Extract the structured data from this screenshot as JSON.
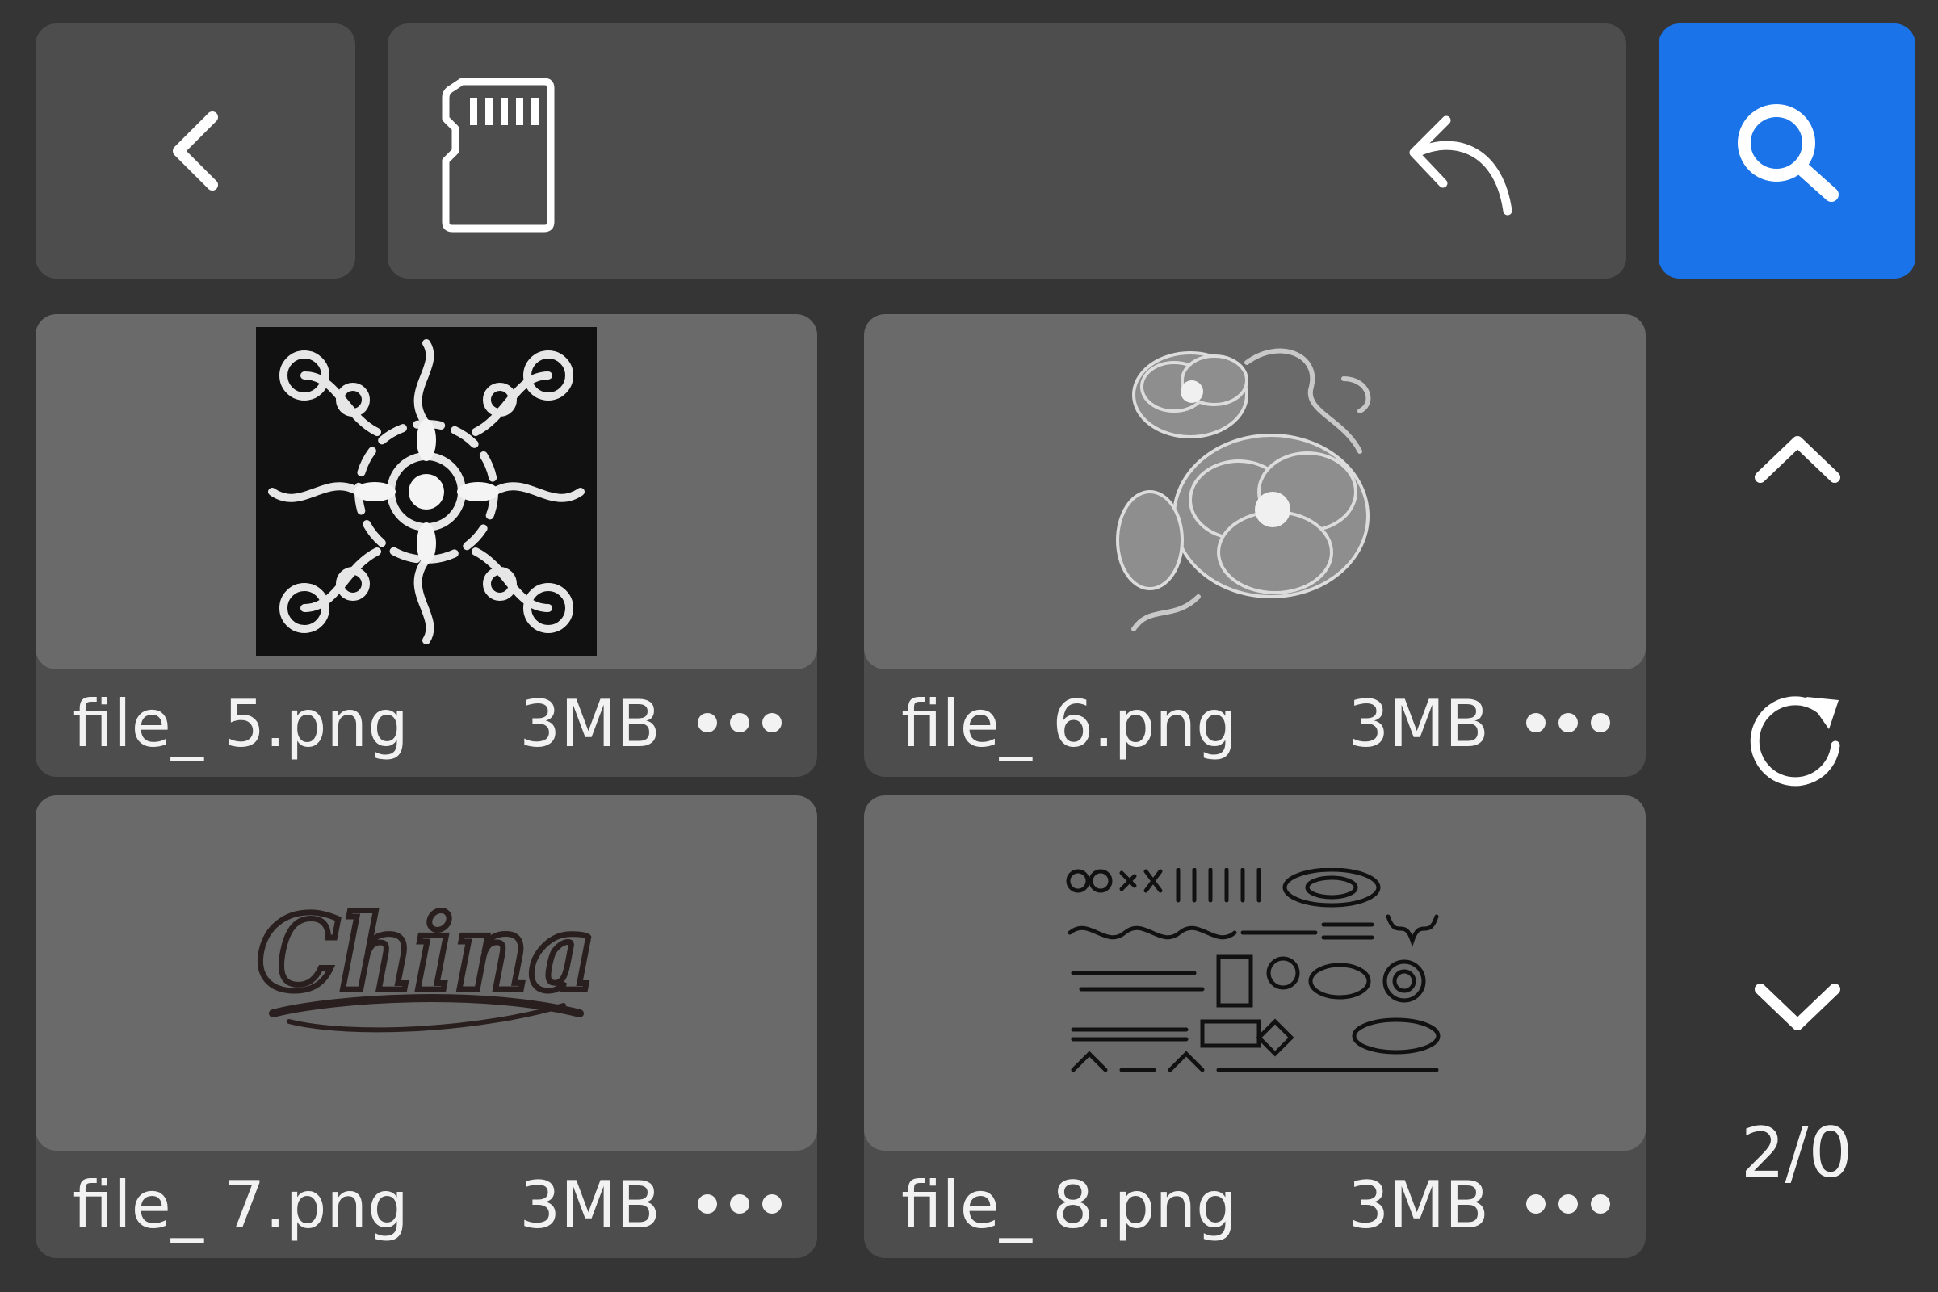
{
  "toolbar": {
    "back_icon": "chevron-left-icon",
    "storage_icon": "sd-card-icon",
    "up_icon": "undo-arrow-icon",
    "search_icon": "search-icon",
    "accent_color": "#1a73e8"
  },
  "files": [
    {
      "name": "file_ 5.png",
      "size": "3MB",
      "thumb": "ornamental-tile"
    },
    {
      "name": "file_ 6.png",
      "size": "3MB",
      "thumb": "peony-flowers"
    },
    {
      "name": "file_ 7.png",
      "size": "3MB",
      "thumb": "china-lettering"
    },
    {
      "name": "file_ 8.png",
      "size": "3MB",
      "thumb": "symbol-sheet"
    }
  ],
  "lettering": {
    "china": "China"
  },
  "side": {
    "scroll_up_icon": "chevron-up-icon",
    "refresh_icon": "refresh-icon",
    "scroll_down_icon": "chevron-down-icon",
    "page_indicator": "2/0"
  }
}
